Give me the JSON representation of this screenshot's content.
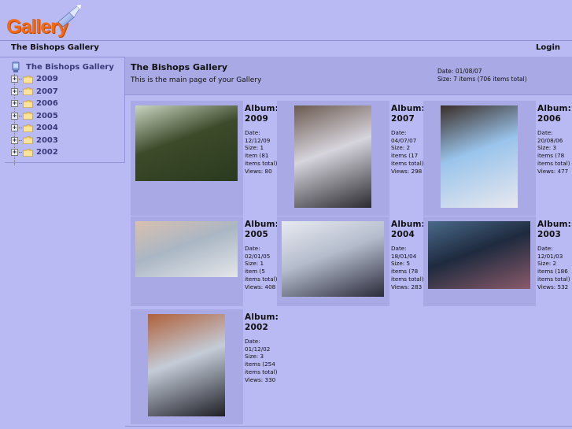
{
  "header": {
    "logo_text": "Gallery",
    "logo_icon": "gallery-logo-icon"
  },
  "navbar": {
    "breadcrumb": "The Bishops Gallery",
    "login_label": "Login"
  },
  "sidebar": {
    "root": {
      "label": "The Bishops Gallery",
      "icon": "gallery-root-icon"
    },
    "items": [
      {
        "label": "2009",
        "icon": "folder-icon",
        "expander": "+"
      },
      {
        "label": "2007",
        "icon": "folder-icon",
        "expander": "+"
      },
      {
        "label": "2006",
        "icon": "folder-icon",
        "expander": "+"
      },
      {
        "label": "2005",
        "icon": "folder-icon",
        "expander": "+"
      },
      {
        "label": "2004",
        "icon": "folder-icon",
        "expander": "+"
      },
      {
        "label": "2003",
        "icon": "folder-icon",
        "expander": "+"
      },
      {
        "label": "2002",
        "icon": "folder-icon",
        "expander": "+"
      }
    ]
  },
  "main": {
    "title": "The Bishops Gallery",
    "description": "This is the main page of your Gallery",
    "date": "Date: 01/08/07",
    "size": "Size: 7 items (706 items total)"
  },
  "albums": [
    {
      "title": "Album: 2009",
      "date": "Date: 12/12/09",
      "size": "Size: 1 item (81 items total)",
      "views": "Views: 80",
      "thumb_colors": [
        "#3d4a2a",
        "#c8d4c0",
        "#2a3a1e"
      ]
    },
    {
      "title": "Album: 2007",
      "date": "Date: 04/07/07",
      "size": "Size: 2 items (17 items total)",
      "views": "Views: 298",
      "thumb_colors": [
        "#d6d4dc",
        "#6b5a50",
        "#2a2a30"
      ]
    },
    {
      "title": "Album: 2006",
      "date": "Date: 20/08/06",
      "size": "Size: 3 items (78 items total)",
      "views": "Views: 477",
      "thumb_colors": [
        "#9ac4ec",
        "#3a2e28",
        "#e8e8ee"
      ]
    },
    {
      "title": "Album: 2005",
      "date": "Date: 02/01/05",
      "size": "Size: 1 item (5 items total)",
      "views": "Views: 408",
      "thumb_colors": [
        "#aab6c4",
        "#d8c0b0",
        "#e4e6ea"
      ]
    },
    {
      "title": "Album: 2004",
      "date": "Date: 18/01/04",
      "size": "Size: 5 items (78 items total)",
      "views": "Views: 283",
      "thumb_colors": [
        "#b4bccc",
        "#e8eaf0",
        "#2a2a3a"
      ]
    },
    {
      "title": "Album: 2003",
      "date": "Date: 12/01/03",
      "size": "Size: 2 items (186 items total)",
      "views": "Views: 532",
      "thumb_colors": [
        "#1e2a3e",
        "#4a6a8a",
        "#8a5a6a"
      ]
    },
    {
      "title": "Album: 2002",
      "date": "Date: 01/12/02",
      "size": "Size: 3 items (254 items total)",
      "views": "Views: 330",
      "thumb_colors": [
        "#c4ccd8",
        "#b0603a",
        "#1e1e26"
      ]
    }
  ]
}
